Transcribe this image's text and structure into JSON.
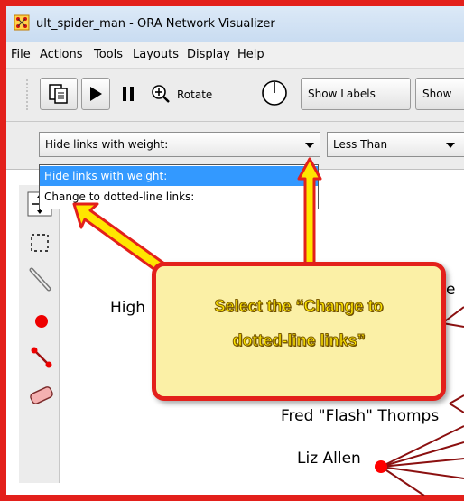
{
  "window": {
    "title": "ult_spider_man - ORA Network Visualizer"
  },
  "menu": [
    "File",
    "Actions",
    "Tools",
    "Layouts",
    "Display",
    "Help"
  ],
  "toolbar": {
    "rotate_label": "Rotate",
    "show_labels": "Show Labels",
    "show_partial": "Show"
  },
  "filter": {
    "selected": "Hide links with weight:",
    "comparator": "Less Than",
    "options": [
      "Hide links with weight:",
      "Change to dotted-line links:"
    ]
  },
  "nodes": {
    "high": "High",
    "fred": "Fred \"Flash\" Thomps",
    "liz": "Liz Allen",
    "partial_e": "e"
  },
  "callout": {
    "line1": "Select the “Change to",
    "line2": "dotted-line links”"
  },
  "colors": {
    "accent": "#e3201b",
    "callout_fill": "#fbf0a6",
    "callout_text": "#ffe600",
    "selection": "#3399ff",
    "node": "#ff0000",
    "edge": "#a01010"
  }
}
